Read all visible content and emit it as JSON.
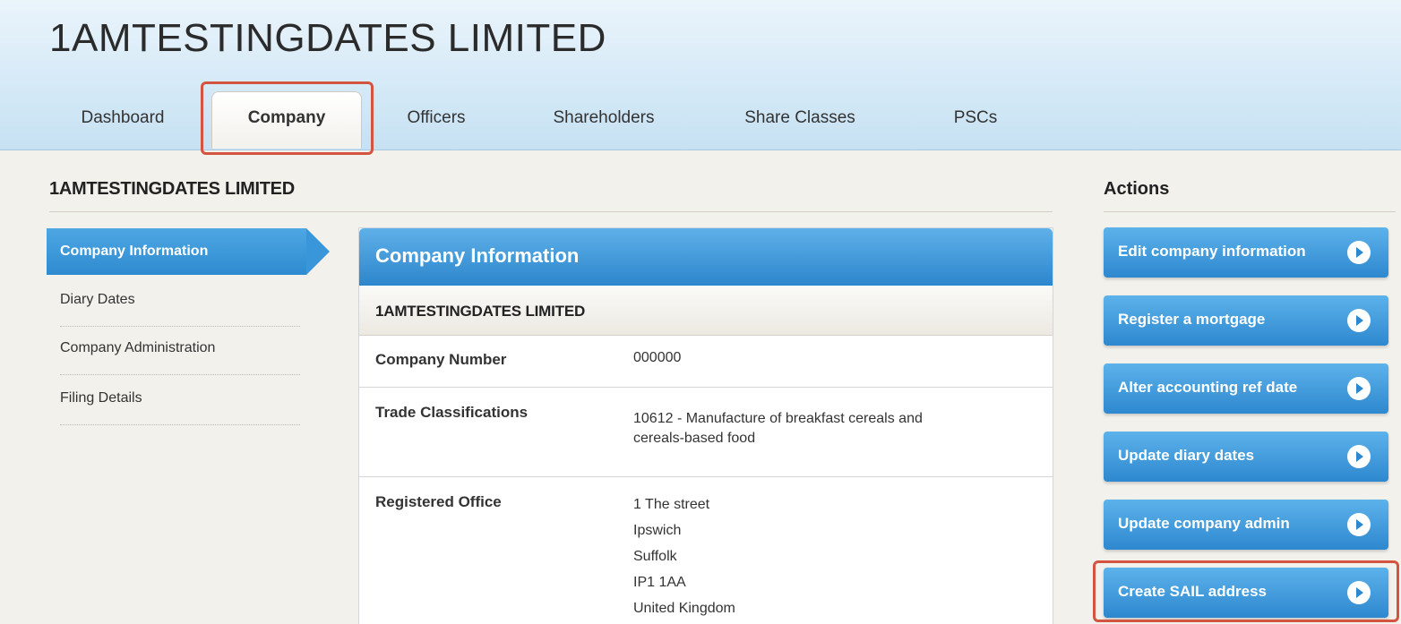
{
  "header": {
    "company_name": "1AMTESTINGDATES LIMITED",
    "tabs": [
      {
        "label": "Dashboard",
        "active": false
      },
      {
        "label": "Company",
        "active": true
      },
      {
        "label": "Officers",
        "active": false
      },
      {
        "label": "Shareholders",
        "active": false
      },
      {
        "label": "Share Classes",
        "active": false
      },
      {
        "label": "PSCs",
        "active": false
      }
    ]
  },
  "section": {
    "title": "1AMTESTINGDATES LIMITED",
    "actions_title": "Actions"
  },
  "sidebar": {
    "items": [
      {
        "label": "Company Information",
        "active": true
      },
      {
        "label": "Diary Dates",
        "active": false
      },
      {
        "label": "Company Administration",
        "active": false
      },
      {
        "label": "Filing Details",
        "active": false
      }
    ]
  },
  "panel": {
    "title": "Company Information",
    "subtitle": "1AMTESTINGDATES LIMITED",
    "rows": [
      {
        "label": "Company Number",
        "value": [
          "000000"
        ]
      },
      {
        "label": "Trade Classifications",
        "value": [
          "10612 - Manufacture of breakfast cereals and",
          "cereals-based food"
        ]
      },
      {
        "label": "Registered Office",
        "value": [
          "1 The street",
          "Ipswich",
          "Suffolk",
          "IP1 1AA",
          "United Kingdom"
        ]
      }
    ]
  },
  "actions": [
    {
      "label": "Edit company information",
      "icon": "play-circle-icon"
    },
    {
      "label": "Register a mortgage",
      "icon": "play-circle-icon"
    },
    {
      "label": "Alter accounting ref date",
      "icon": "play-circle-icon"
    },
    {
      "label": "Update diary dates",
      "icon": "play-circle-icon"
    },
    {
      "label": "Update company admin",
      "icon": "play-circle-icon"
    },
    {
      "label": "Create SAIL address",
      "icon": "play-circle-icon"
    }
  ],
  "colors": {
    "accent": "#2e88cf",
    "highlight": "#d3543f",
    "background": "#f3f1ec"
  }
}
